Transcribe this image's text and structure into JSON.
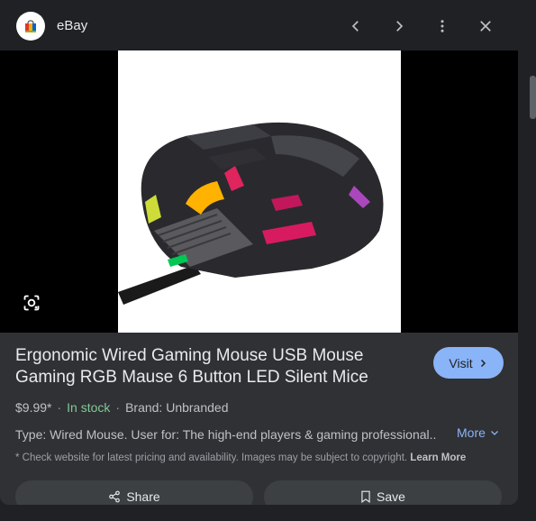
{
  "header": {
    "site_name": "eBay",
    "icons": [
      "shopping-bag-icon",
      "chevron-left-icon",
      "chevron-right-icon",
      "more-vert-icon",
      "close-icon"
    ]
  },
  "media": {
    "image_subject": "mouse",
    "lens_icon": "google-lens-icon"
  },
  "product": {
    "title": "Ergonomic Wired Gaming Mouse USB Mouse Gaming RGB Mause 6 Button LED Silent Mice",
    "price": "$9.99*",
    "stock": "In stock",
    "brand": "Brand: Unbranded",
    "description": "Type: Wired Mouse. User for: The high-end players & gaming professional...",
    "more_label": "More",
    "visit_label": "Visit",
    "disclaimer": "* Check website for latest pricing and availability. Images may be subject to copyright.",
    "learn_more": "Learn More"
  },
  "actions": {
    "share_label": "Share",
    "save_label": "Save"
  },
  "colors": {
    "accent": "#8ab4f8",
    "stock": "#81c995",
    "panel": "#303134",
    "header": "#202124"
  }
}
